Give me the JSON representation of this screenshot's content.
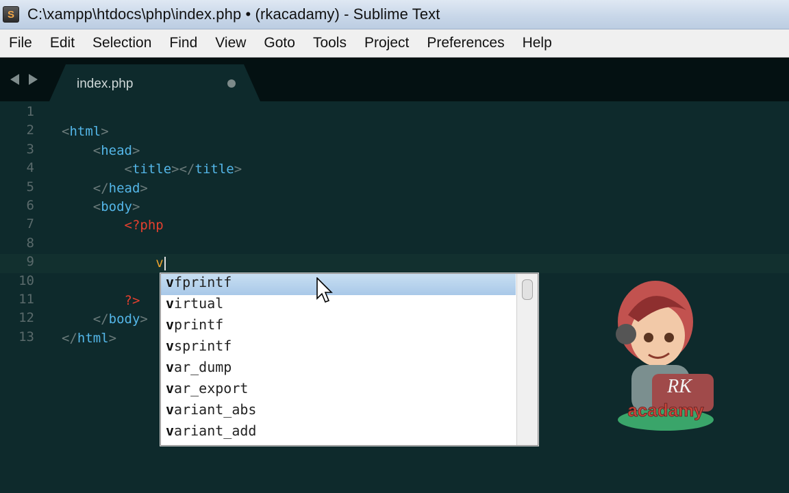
{
  "window": {
    "title": "C:\\xampp\\htdocs\\php\\index.php • (rkacadamy) - Sublime Text",
    "app_icon_letter": "S"
  },
  "menu": [
    "File",
    "Edit",
    "Selection",
    "Find",
    "View",
    "Goto",
    "Tools",
    "Project",
    "Preferences",
    "Help"
  ],
  "tab": {
    "label": "index.php",
    "unsaved": true
  },
  "editor": {
    "line_numbers": [
      "1",
      "2",
      "3",
      "4",
      "5",
      "6",
      "7",
      "8",
      "9",
      "10",
      "11",
      "12",
      "13"
    ],
    "lines": [
      {
        "indent": "",
        "parts": []
      },
      {
        "indent": "",
        "parts": [
          {
            "t": "p",
            "v": "<"
          },
          {
            "t": "tag",
            "v": "html"
          },
          {
            "t": "p",
            "v": ">"
          }
        ]
      },
      {
        "indent": "    ",
        "parts": [
          {
            "t": "p",
            "v": "<"
          },
          {
            "t": "tag",
            "v": "head"
          },
          {
            "t": "p",
            "v": ">"
          }
        ]
      },
      {
        "indent": "        ",
        "parts": [
          {
            "t": "p",
            "v": "<"
          },
          {
            "t": "tag",
            "v": "title"
          },
          {
            "t": "p",
            "v": "></"
          },
          {
            "t": "tag",
            "v": "title"
          },
          {
            "t": "p",
            "v": ">"
          }
        ]
      },
      {
        "indent": "    ",
        "parts": [
          {
            "t": "p",
            "v": "</"
          },
          {
            "t": "tag",
            "v": "head"
          },
          {
            "t": "p",
            "v": ">"
          }
        ]
      },
      {
        "indent": "    ",
        "parts": [
          {
            "t": "p",
            "v": "<"
          },
          {
            "t": "tag",
            "v": "body"
          },
          {
            "t": "p",
            "v": ">"
          }
        ]
      },
      {
        "indent": "        ",
        "parts": [
          {
            "t": "php",
            "v": "<?php"
          }
        ]
      },
      {
        "indent": "",
        "parts": []
      },
      {
        "indent": "            ",
        "parts": [
          {
            "t": "typed",
            "v": "v"
          },
          {
            "t": "caret",
            "v": ""
          }
        ]
      },
      {
        "indent": "",
        "parts": []
      },
      {
        "indent": "        ",
        "parts": [
          {
            "t": "php",
            "v": "?>"
          }
        ]
      },
      {
        "indent": "    ",
        "parts": [
          {
            "t": "p",
            "v": "</"
          },
          {
            "t": "tag",
            "v": "body"
          },
          {
            "t": "p",
            "v": ">"
          }
        ]
      },
      {
        "indent": "",
        "parts": [
          {
            "t": "p",
            "v": "</"
          },
          {
            "t": "tag",
            "v": "html"
          },
          {
            "t": "p",
            "v": ">"
          }
        ]
      }
    ]
  },
  "autocomplete": {
    "typed": "v",
    "items": [
      "vfprintf",
      "virtual",
      "vprintf",
      "vsprintf",
      "var_dump",
      "var_export",
      "variant_abs",
      "variant_add"
    ],
    "selected_index": 0
  },
  "watermark": {
    "line1": "RK",
    "line2": "acadamy"
  },
  "colors": {
    "editor_bg": "#0e2a2c",
    "tag": "#54b6e8",
    "php": "#e4402f",
    "typed": "#e8a22e"
  }
}
